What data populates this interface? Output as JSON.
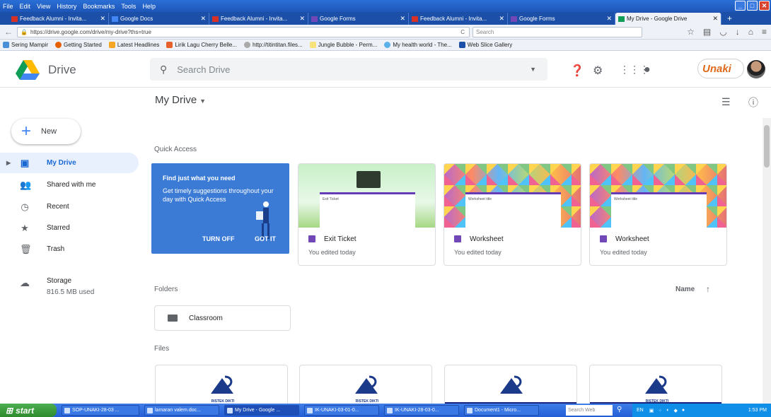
{
  "browser": {
    "menu": [
      "File",
      "Edit",
      "View",
      "History",
      "Bookmarks",
      "Tools",
      "Help"
    ],
    "tabs": [
      {
        "label": "Feedback Alumni - Invita...",
        "color": "#d93025"
      },
      {
        "label": "Google Docs",
        "color": "#4285f4"
      },
      {
        "label": "Feedback Alumni - Invita...",
        "color": "#d93025"
      },
      {
        "label": "Google Forms",
        "color": "#7248b9"
      },
      {
        "label": "Feedback Alumni - Invita...",
        "color": "#d93025"
      },
      {
        "label": "Google Forms",
        "color": "#7248b9"
      },
      {
        "label": "My Drive - Google Drive",
        "color": "#0f9d58"
      }
    ],
    "url": "https://drive.google.com/drive/my-drive?ths=true",
    "search_placeholder": "Search",
    "bookmarks": [
      "Sering Mampir",
      "Getting Started",
      "Latest Headlines",
      "Lirik Lagu Cherry Belle...",
      "http://titintitan.files...",
      "Jungle Bubble - Perm...",
      "My health world - The...",
      "Web Slice Gallery"
    ]
  },
  "drive": {
    "app_name": "Drive",
    "search_placeholder": "Search Drive",
    "brand": "Unaki",
    "new_label": "New",
    "nav": [
      {
        "label": "My Drive",
        "icon": "drive-icon"
      },
      {
        "label": "Shared with me",
        "icon": "people-icon"
      },
      {
        "label": "Recent",
        "icon": "clock-icon"
      },
      {
        "label": "Starred",
        "icon": "star-icon"
      },
      {
        "label": "Trash",
        "icon": "trash-icon"
      }
    ],
    "storage_label": "Storage",
    "storage_used": "816.5 MB used",
    "title": "My Drive",
    "quick_access": "Quick Access",
    "qa_card": {
      "heading": "Find just what you need",
      "body": "Get timely suggestions throughout your day with Quick Access",
      "turn_off": "TURN OFF",
      "got_it": "GOT IT"
    },
    "files_qa": [
      {
        "name": "Exit Ticket",
        "edited": "You edited today",
        "thumb_title": "Exit Ticket"
      },
      {
        "name": "Worksheet",
        "edited": "You edited today",
        "thumb_title": "Worksheet title"
      },
      {
        "name": "Worksheet",
        "edited": "You edited today",
        "thumb_title": "Worksheet title"
      }
    ],
    "folders_label": "Folders",
    "sort_label": "Name",
    "folders": [
      {
        "name": "Classroom"
      }
    ],
    "files_label": "Files",
    "file_thumb_text": "RISTEK DIKTI"
  },
  "taskbar": {
    "start": "start",
    "items": [
      "SOP-UNAKI-28-03 ...",
      "lamaran valem.doc...",
      "My Drive - Google ...",
      "IK-UNAKI-03-01-0...",
      "IK-UNAKI-28-03-0...",
      "Document1 - Micro..."
    ],
    "web_search": "Search Web",
    "lang": "EN",
    "time": "1:53 PM"
  }
}
